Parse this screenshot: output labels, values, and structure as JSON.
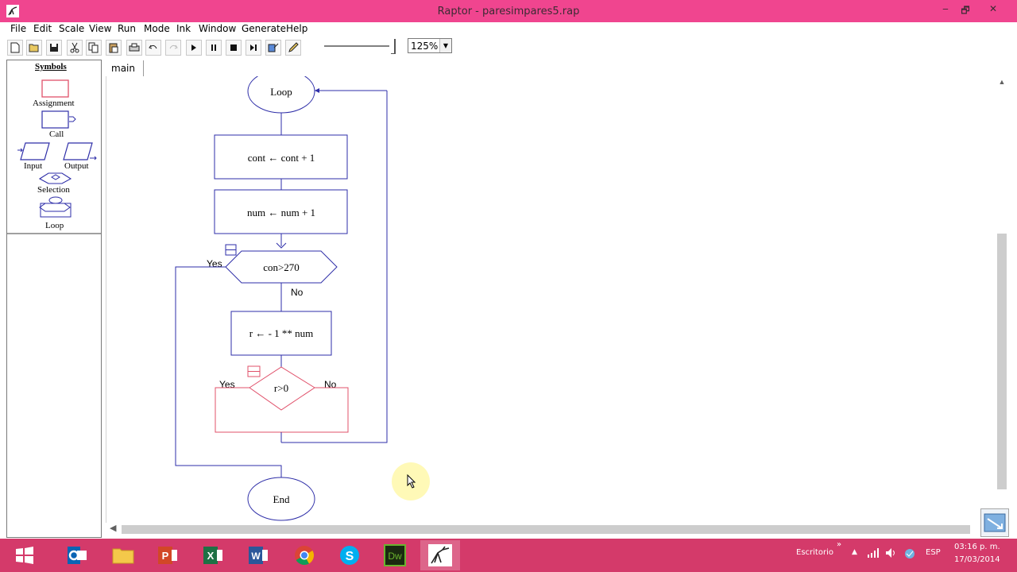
{
  "window": {
    "title": "Raptor - paresimpares5.rap",
    "minimize": "‒",
    "restore": "🗗",
    "close": "✕"
  },
  "menu": [
    "File",
    "Edit",
    "Scale",
    "View",
    "Run",
    "Mode",
    "Ink",
    "Window",
    "Generate",
    "Help"
  ],
  "toolbar": {
    "buttons": [
      "new-icon",
      "open-icon",
      "save-icon",
      "cut-icon",
      "copy-icon",
      "paste-icon",
      "print-icon",
      "undo-icon",
      "redo-icon",
      "play-icon",
      "pause-icon",
      "stop-icon",
      "step-icon",
      "test-icon",
      "pen-icon"
    ],
    "zoom": "125%"
  },
  "symbols": {
    "heading": "Symbols",
    "assignment": "Assignment",
    "call": "Call",
    "input": "Input",
    "output": "Output",
    "selection": "Selection",
    "loop": "Loop"
  },
  "tabs": {
    "main": "main"
  },
  "flowchart": {
    "loop_label": "Loop",
    "assign1": "cont ← cont + 1",
    "assign2": "num ← num + 1",
    "condition1": "con>270",
    "cond1_yes": "Yes",
    "cond1_no": "No",
    "assign3": "r ← - 1 ** num",
    "condition2": "r>0",
    "cond2_yes": "Yes",
    "cond2_no": "No",
    "end_label": "End"
  },
  "taskbar": {
    "apps": [
      "windows-start-icon",
      "outlook-icon",
      "file-explorer-icon",
      "powerpoint-icon",
      "excel-icon",
      "word-icon",
      "chrome-icon",
      "skype-icon",
      "dreamweaver-icon",
      "raptor-icon"
    ],
    "desktop_label": "Escritorio",
    "language": "ESP",
    "time": "03:16 p. m.",
    "date": "17/03/2014"
  },
  "colors": {
    "titlebar": "#f0458f",
    "taskbar": "#d43a6a",
    "flow_blue": "#2e2ea8",
    "selection_red": "#e0506a"
  }
}
